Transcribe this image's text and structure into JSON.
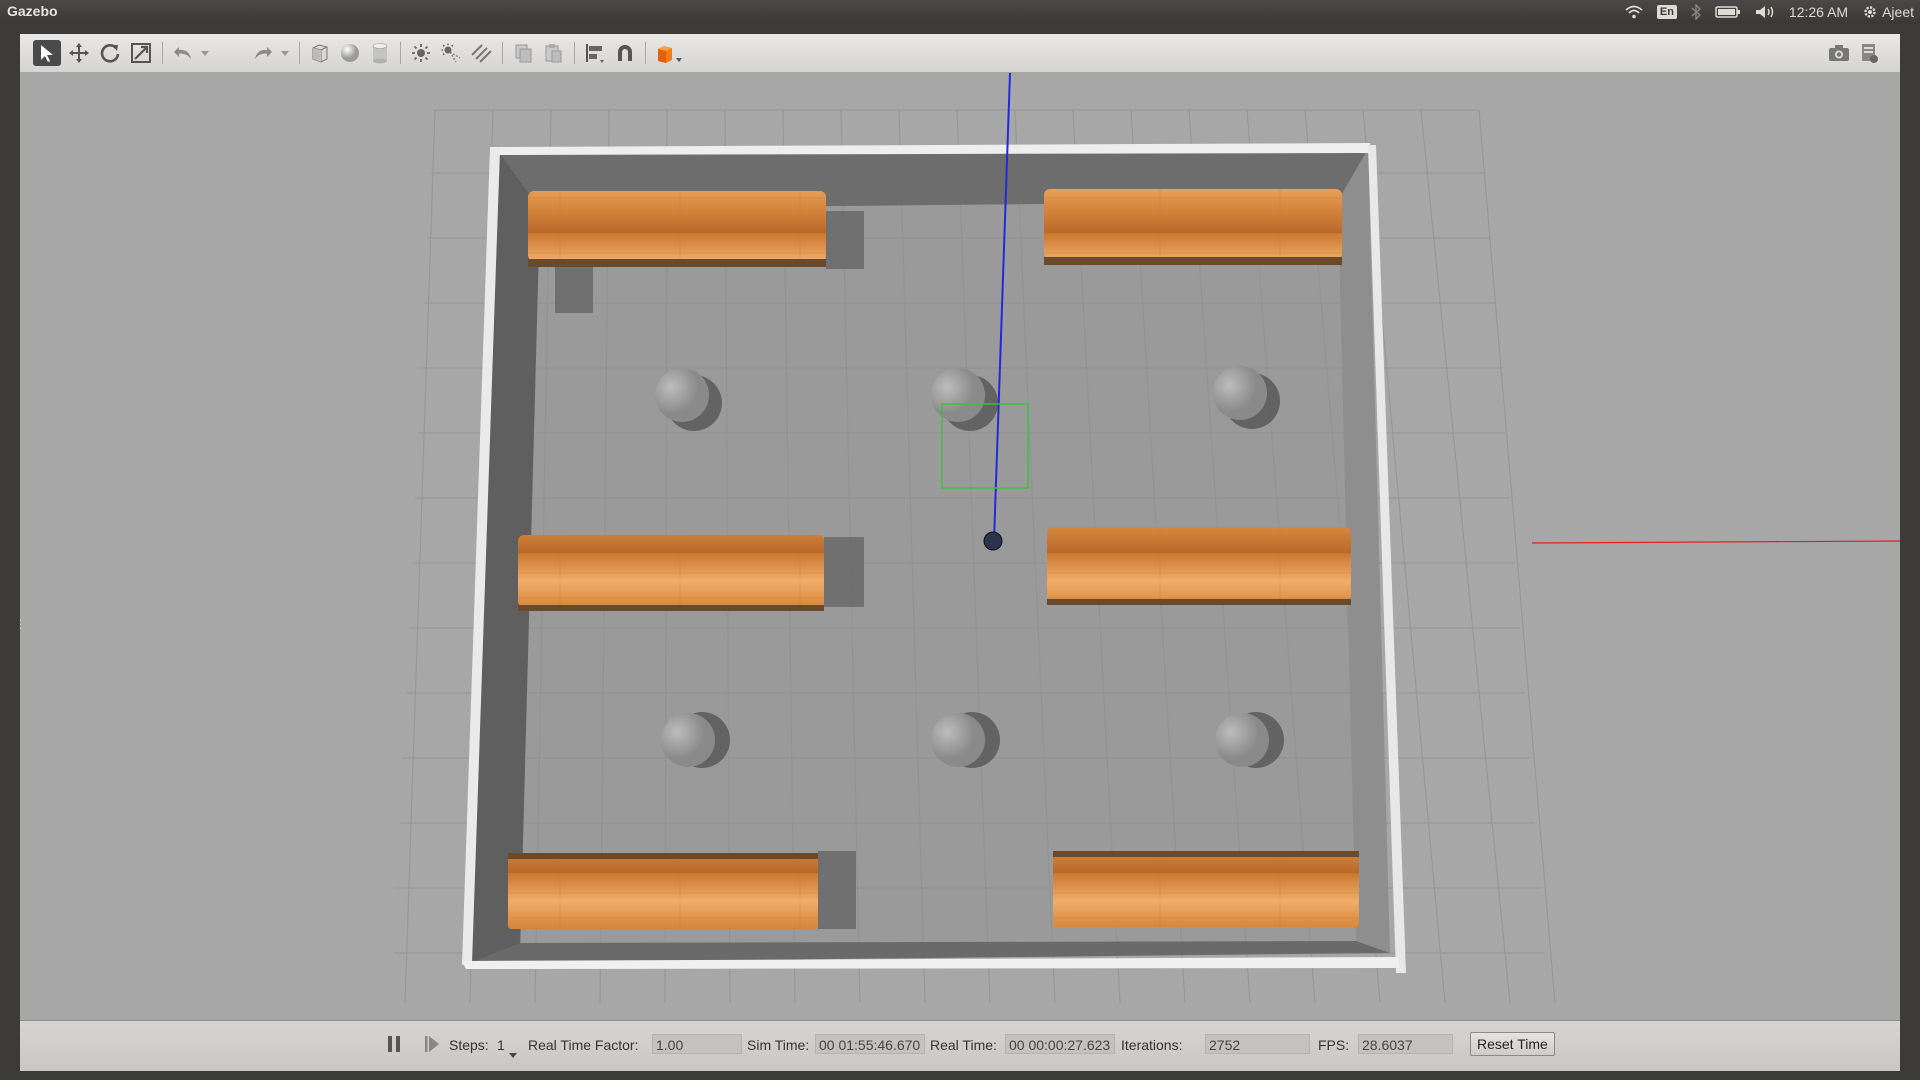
{
  "app": {
    "title": "Gazebo"
  },
  "system_tray": {
    "language": "En",
    "clock": "12:26 AM",
    "user": "Ajeet",
    "icons": [
      "wifi-icon",
      "bluetooth-icon",
      "battery-icon",
      "volume-icon",
      "settings-gear-icon"
    ]
  },
  "toolbar": {
    "tools": [
      "select-mode",
      "translate-mode",
      "rotate-mode",
      "scale-mode",
      "undo",
      "redo",
      "box",
      "sphere",
      "cylinder",
      "point-light",
      "spot-light",
      "directional-light",
      "copy",
      "paste",
      "align",
      "snap",
      "change-view"
    ],
    "right_tools": [
      "screenshot",
      "log"
    ]
  },
  "colors": {
    "viewport_bg": "#a7a7a7",
    "floor": "#909090",
    "shelf_wood": "#d98a3c",
    "z_axis": "#1f2bd6",
    "x_axis": "#e02020",
    "selection_box": "#35c635"
  },
  "status_bar": {
    "steps_label": "Steps:",
    "steps_value": "1",
    "rtf_label": "Real Time Factor:",
    "rtf_value": "1.00",
    "sim_time_label": "Sim Time:",
    "sim_time_value": "00 01:55:46.670",
    "real_time_label": "Real Time:",
    "real_time_value": "00 00:00:27.623",
    "iterations_label": "Iterations:",
    "iterations_value": "2752",
    "fps_label": "FPS:",
    "fps_value": "28.6037",
    "reset_time_label": "Reset Time"
  }
}
